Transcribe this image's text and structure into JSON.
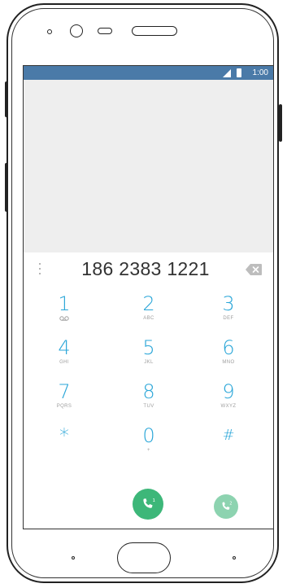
{
  "status_bar": {
    "time": "1:00",
    "background_color": "#4a7aa8",
    "signal_icon": "cell-signal-icon",
    "battery_icon": "battery-icon"
  },
  "dialer": {
    "number": "186 2383 1221",
    "accent_color": "#2aa6d8",
    "overflow_icon": "overflow-menu-icon",
    "backspace_icon": "backspace-icon",
    "keys": [
      {
        "digit": "1",
        "letters": "voicemail-icon"
      },
      {
        "digit": "2",
        "letters": "ABC"
      },
      {
        "digit": "3",
        "letters": "DEF"
      },
      {
        "digit": "4",
        "letters": "GHI"
      },
      {
        "digit": "5",
        "letters": "JKL"
      },
      {
        "digit": "6",
        "letters": "MNO"
      },
      {
        "digit": "7",
        "letters": "PQRS"
      },
      {
        "digit": "8",
        "letters": "TUV"
      },
      {
        "digit": "9",
        "letters": "WXYZ"
      },
      {
        "digit": "*",
        "letters": ""
      },
      {
        "digit": "0",
        "letters": "+"
      },
      {
        "digit": "#",
        "letters": ""
      }
    ],
    "call_buttons": [
      {
        "sim": "1",
        "color": "#3db779"
      },
      {
        "sim": "2",
        "color": "#8dd3b0"
      }
    ]
  }
}
